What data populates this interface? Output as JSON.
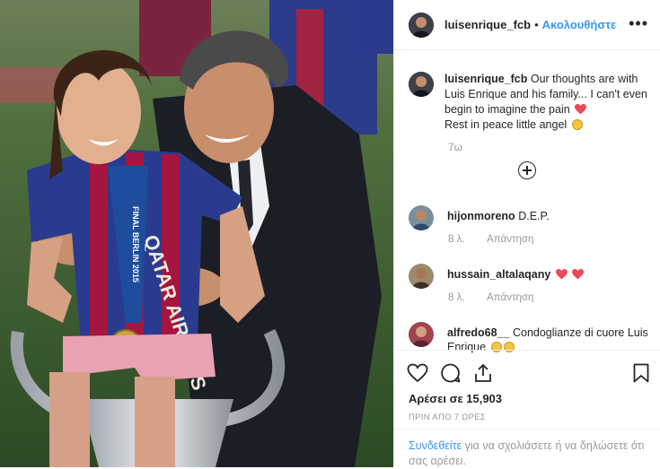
{
  "header": {
    "username": "luisenrique_fcb",
    "separator": "•",
    "follow_label": "Ακολουθήστε",
    "more_label": "•••"
  },
  "caption": {
    "username": "luisenrique_fcb",
    "text": "Our thoughts are with Luis Enrique and his family... I can't even begin to imagine the pain",
    "text2": "Rest in peace little angel",
    "time": "7ω"
  },
  "comments": [
    {
      "username": "hijonmoreno",
      "text": "D.E.P.",
      "time": "8 λ.",
      "reply": "Απάντηση"
    },
    {
      "username": "hussain_altalaqany",
      "text": "",
      "time": "8 λ.",
      "reply": "Απάντηση"
    },
    {
      "username": "alfredo68__",
      "text": "Condoglianze di cuore Luis Enrique",
      "time": "",
      "reply": ""
    }
  ],
  "likes": "Αρέσει σε 15,903",
  "posted_ago": "ΠΡΙΝ ΑΠΟ 7 ΩΡΕΣ",
  "footer": {
    "login_link": "Συνδεθείτε",
    "text": "για να σχολιάσετε ή να δηλώσετε ότι σας αρέσει."
  },
  "photo": {
    "medal_text": "FINAL BERLIN 2015",
    "shirt_text": "QATAR AIRWAYS"
  },
  "colors": {
    "accent": "#3897f0",
    "heart": "#ed4956",
    "muted": "#999999"
  }
}
